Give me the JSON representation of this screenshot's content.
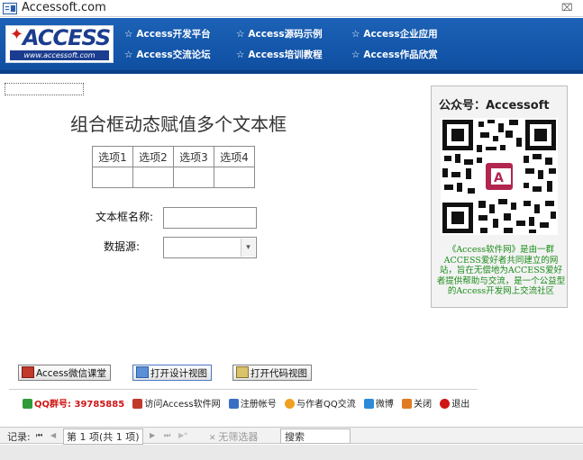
{
  "window": {
    "title": "Accessoft.com",
    "close_label": "⌧"
  },
  "header": {
    "logo_text": "ACCESS",
    "logo_url": "www.accessoft.com",
    "nav": [
      {
        "label": "Access开发平台"
      },
      {
        "label": "Access源码示例"
      },
      {
        "label": "Access企业应用"
      },
      {
        "label": "Access交流论坛"
      },
      {
        "label": "Access培训教程"
      },
      {
        "label": "Access作品欣赏"
      }
    ],
    "star": "☆"
  },
  "form": {
    "title": "组合框动态赋值多个文本框",
    "options": [
      "选项1",
      "选项2",
      "选项3",
      "选项4"
    ],
    "textbox_label": "文本框名称:",
    "textbox_value": "",
    "datasource_label": "数据源:",
    "datasource_value": "",
    "combo_arrow": "▾"
  },
  "qr_panel": {
    "title": "公众号：Accessoft",
    "description": "《Access软件网》是由一群ACCESS爱好者共同建立的网站，旨在无偿地为ACCESS爱好者提供帮助与交流，是一个公益型的Access开发网上交流社区"
  },
  "buttons": {
    "wechat_class": "Access微信课堂",
    "open_design": "打开设计视图",
    "open_code": "打开代码视图"
  },
  "links": [
    {
      "label": "QQ群号: 39785885",
      "color": "#d01515"
    },
    {
      "label": "访问Access软件网",
      "color": "#222222"
    },
    {
      "label": "注册帐号",
      "color": "#222222"
    },
    {
      "label": "与作者QQ交流",
      "color": "#222222"
    },
    {
      "label": "微博",
      "color": "#222222"
    },
    {
      "label": "关闭",
      "color": "#222222"
    },
    {
      "label": "退出",
      "color": "#222222"
    }
  ],
  "record_nav": {
    "label": "记录:",
    "first": "⏮",
    "prev": "◀",
    "position": "第 1 项(共 1 项)",
    "next": "▶",
    "last": "⏭",
    "new": "▶*",
    "filter": "无筛选器",
    "search": "搜索"
  },
  "colors": {
    "header_blue": "#1558ad",
    "qr_text_green": "#1a8c1a",
    "qq_red": "#d01515"
  }
}
